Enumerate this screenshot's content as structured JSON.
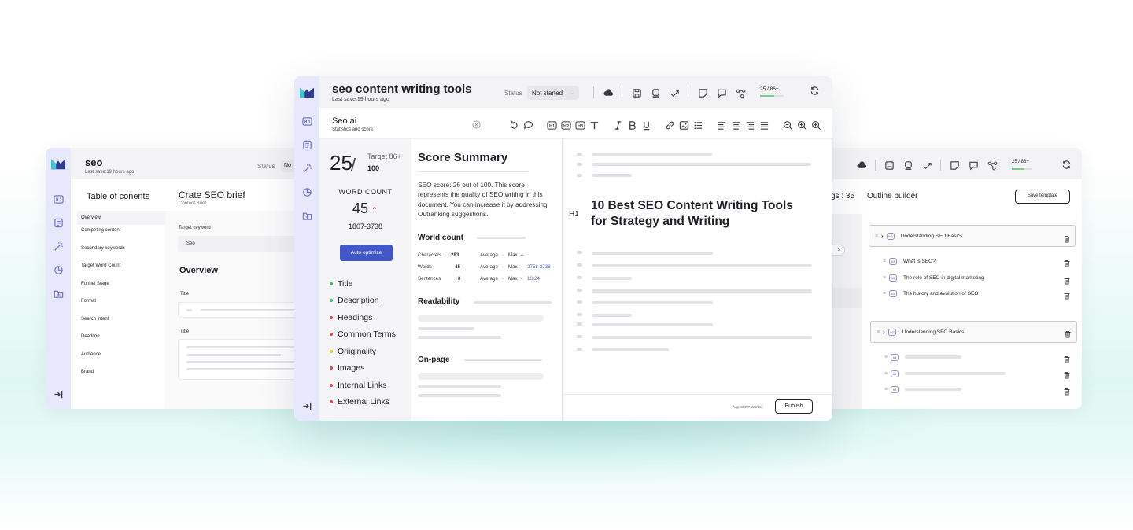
{
  "left_window": {
    "title": "seo",
    "last_save": "Last save:19 hours ago",
    "status_label": "Status",
    "status_value": "No",
    "toc_heading": "Table of conents",
    "toc_items": [
      "Overview",
      "Competing content",
      "Secondary keywords",
      "Target Word Count",
      "Funnel Stage",
      "Format",
      "Search intent",
      "Deadline",
      "Audience",
      "Brand"
    ],
    "brief_title": "Crate SEO brief",
    "brief_subtitle": "Content Brief",
    "target_keyword_label": "Target keyword",
    "target_keyword_value": "Seo",
    "overview_heading": "Overview",
    "title_label_1": "Title",
    "title_label_2": "Title"
  },
  "center_window": {
    "title": "seo content writing tools",
    "last_save": "Last save:19 hours ago",
    "status_label": "Status",
    "status_value": "Not started",
    "progress_text": "25 / 86+",
    "panel_title": "Seo ai",
    "panel_subtitle": "Statistics and score",
    "score": "25",
    "target_label": "Target 86+",
    "target_value": "100",
    "word_count_label": "WORD  COUNT",
    "word_count_value": "45",
    "word_count_range": "1807-3738",
    "auto_optimize": "Auto optimize",
    "checklist": [
      {
        "label": "Title",
        "color": "#3fb965"
      },
      {
        "label": "Description",
        "color": "#3fb965"
      },
      {
        "label": "Headings",
        "color": "#e04848"
      },
      {
        "label": "Common Terms",
        "color": "#e04848"
      },
      {
        "label": "Oriiginality",
        "color": "#e8c033"
      },
      {
        "label": "Images",
        "color": "#e04848"
      },
      {
        "label": "Internal Links",
        "color": "#e04848"
      },
      {
        "label": "External Links",
        "color": "#e04848"
      }
    ],
    "summary_heading": "Score Summary",
    "summary_text": "SEO score: 26 out of 100. This score represents the quality of SEO writing in this document. You can increase it by addressing Outranking suggestions.",
    "world_count_heading": "World count",
    "stats": {
      "characters_label": "Characters",
      "characters_value": "283",
      "words_label": "Words",
      "words_value": "45",
      "sentences_label": "Sentences",
      "sentences_value": "0",
      "average": "Average",
      "max": "Max",
      "chars_range": "–",
      "words_range": "2758-3738",
      "sentences_range": "13-24"
    },
    "readability_heading": "Readability",
    "onpage_heading": "On-page",
    "h1_label": "H1",
    "h1_text": "10 Best SEO Content Writing Tools for Strategy and Writing",
    "avg_serp": "Avg. SERP Words :",
    "publish": "Publish"
  },
  "right_window": {
    "progress_text": "25 / 86+",
    "headings_count": "gs : 35",
    "outline_builder": "Outline builder",
    "save_template": "Save template",
    "partial_text": "s",
    "sections": [
      {
        "tag": "h2",
        "title": "Understanding SEO Basics",
        "children": [
          {
            "tag": "h3",
            "title": "What is SEO?"
          },
          {
            "tag": "h3",
            "title": "The role of SEO in digital marketing"
          },
          {
            "tag": "h3",
            "title": "The history and evolution of SEO"
          }
        ]
      },
      {
        "tag": "h2",
        "title": "Understanding SEO Basics",
        "children": [
          {
            "tag": "h3",
            "title": ""
          },
          {
            "tag": "h3",
            "title": ""
          },
          {
            "tag": "h3",
            "title": ""
          }
        ]
      }
    ]
  },
  "colors": {
    "accent": "#4156c9",
    "rail": "#e7e8fb",
    "good": "#3fb965",
    "bad": "#e04848",
    "warn": "#e8c033"
  }
}
